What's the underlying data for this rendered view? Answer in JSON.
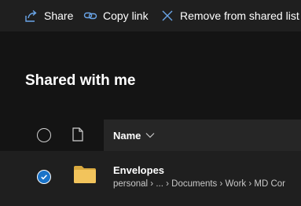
{
  "toolbar": {
    "share_label": "Share",
    "copy_link_label": "Copy link",
    "remove_label": "Remove from shared list"
  },
  "page": {
    "title": "Shared with me"
  },
  "table": {
    "name_header": "Name",
    "rows": [
      {
        "name": "Envelopes",
        "path": "personal › ... › Documents › Work › MD Cor",
        "selected": true,
        "icon": "folder-icon"
      }
    ]
  },
  "colors": {
    "background": "#141414",
    "toolbar": "#1f1f1f",
    "header_cell": "#262626",
    "row": "#1f1f1f",
    "accent": "#1a73c8",
    "folder": "#f2c45c",
    "icon_blue": "#6aa5e8"
  }
}
